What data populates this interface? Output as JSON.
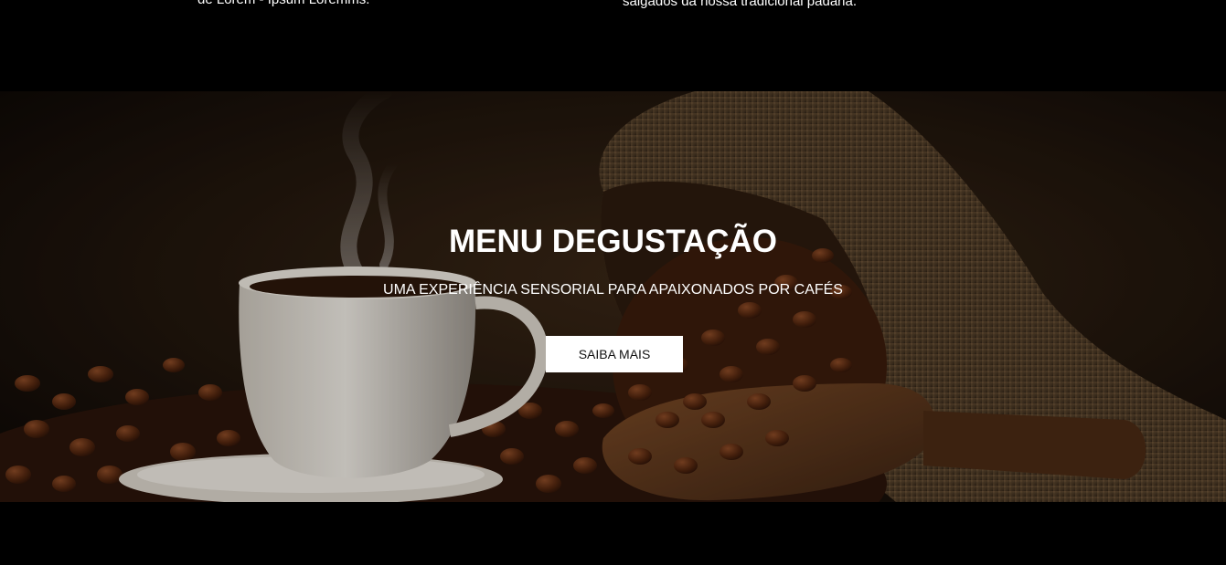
{
  "top_section": {
    "left_text": "de Lorem - Ipsum Loremms.",
    "right_text": "salgados da nossa tradicional padaria."
  },
  "hero": {
    "title": "MENU DEGUSTAÇÃO",
    "subtitle": "UMA EXPERIÊNCIA SENSORIAL PARA APAIXONADOS POR CAFÉS",
    "button_label": "SAIBA MAIS",
    "image_subject": "coffee-cup-beans-burlap-sack"
  },
  "colors": {
    "page_background": "#000000",
    "button_background": "#ffffff",
    "button_text": "#111111",
    "hero_text": "#ffffff"
  }
}
